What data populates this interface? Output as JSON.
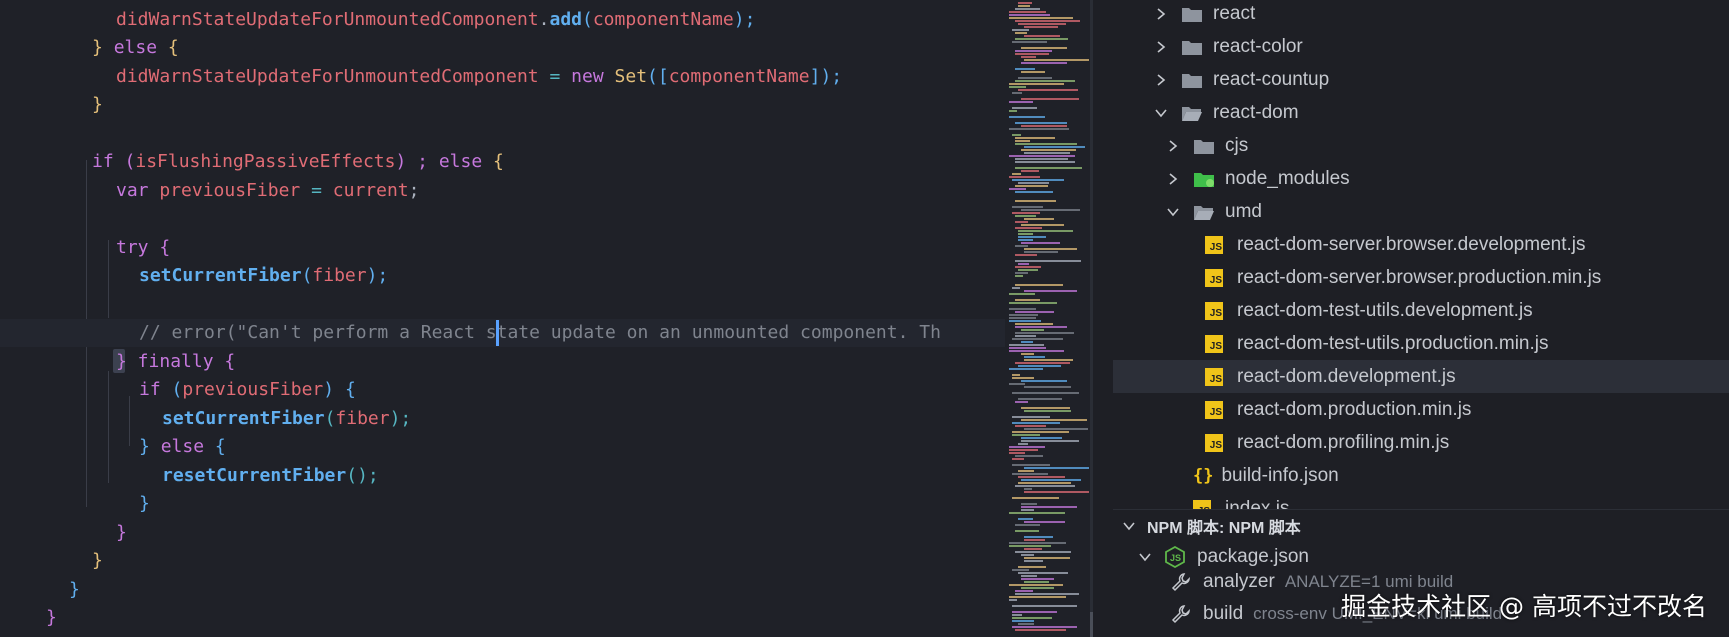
{
  "editor": {
    "line1": {
      "a": "didWarnStateUpdateForUnmountedComponent",
      "b": ".",
      "c": "add",
      "d": "(",
      "e": "componentName",
      "f": ");"
    },
    "line2": {
      "a": "} ",
      "b": "else",
      "c": " {"
    },
    "line3": {
      "a": "didWarnStateUpdateForUnmountedComponent",
      "b": " = ",
      "c": "new",
      "d": " ",
      "e": "Set",
      "f": "([",
      "g": "componentName",
      "h": "]);"
    },
    "line4": {
      "a": "}"
    },
    "line5": {
      "a": "if",
      "b": " (",
      "c": "isFlushingPassiveEffects",
      "d": ") ; ",
      "e": "else",
      "f": " {"
    },
    "line6": {
      "a": "var",
      "b": " ",
      "c": "previousFiber",
      "d": " = ",
      "e": "current",
      "f": ";"
    },
    "line7": {
      "a": "try",
      "b": " {"
    },
    "line8": {
      "a": "setCurrentFiber",
      "b": "(",
      "c": "fiber",
      "d": ");"
    },
    "line9": {
      "a": "// error(\"Can't perform a React",
      "b": " state update on an unmounted component. Th"
    },
    "line10": {
      "a": "}",
      "b": " finally",
      "c": " {"
    },
    "line11": {
      "a": "if",
      "b": " (",
      "c": "previousFiber",
      "d": ") {"
    },
    "line12": {
      "a": "setCurrentFiber",
      "b": "(",
      "c": "fiber",
      "d": ");"
    },
    "line13": {
      "a": "} ",
      "b": "else",
      "c": " {"
    },
    "line14": {
      "a": "resetCurrentFiber",
      "b": "();"
    },
    "line15": {
      "a": "}"
    },
    "line16": {
      "a": "}"
    },
    "line17": {
      "a": "}"
    },
    "line18": {
      "a": "}"
    },
    "line19": {
      "a": "}"
    }
  },
  "explorer": {
    "items": [
      {
        "label": "react",
        "type": "folder",
        "state": "collapsed"
      },
      {
        "label": "react-color",
        "type": "folder",
        "state": "collapsed"
      },
      {
        "label": "react-countup",
        "type": "folder",
        "state": "collapsed"
      },
      {
        "label": "react-dom",
        "type": "folder",
        "state": "expanded"
      },
      {
        "label": "cjs",
        "type": "folder",
        "state": "collapsed"
      },
      {
        "label": "node_modules",
        "type": "folder",
        "state": "collapsed"
      },
      {
        "label": "umd",
        "type": "folder",
        "state": "expanded"
      },
      {
        "label": "react-dom-server.browser.development.js",
        "type": "js"
      },
      {
        "label": "react-dom-server.browser.production.min.js",
        "type": "js"
      },
      {
        "label": "react-dom-test-utils.development.js",
        "type": "js"
      },
      {
        "label": "react-dom-test-utils.production.min.js",
        "type": "js"
      },
      {
        "label": "react-dom.development.js",
        "type": "js",
        "selected": true
      },
      {
        "label": "react-dom.production.min.js",
        "type": "js"
      },
      {
        "label": "react-dom.profiling.min.js",
        "type": "js"
      },
      {
        "label": "build-info.json",
        "type": "json"
      },
      {
        "label": "index.js",
        "type": "js"
      }
    ],
    "js_badge": "JS",
    "json_badge": "{}"
  },
  "npm": {
    "header": "NPM 脚本: NPM 脚本",
    "package": "package.json",
    "scripts": [
      {
        "name": "analyzer",
        "command": "ANALYZE=1 umi build"
      },
      {
        "name": "build",
        "command": "cross-env UMI_ENV=kl umi build"
      }
    ]
  },
  "watermark": "掘金技术社区 @ 高项不过不改名",
  "colors": {
    "editor_bg": "#1f2128",
    "sidebar_bg": "#1e1f25",
    "caret": "#5aa2ff",
    "selected_row": "#2c2f38",
    "js_badge": "#f0c419",
    "folder_green": "#3fbf4a"
  }
}
